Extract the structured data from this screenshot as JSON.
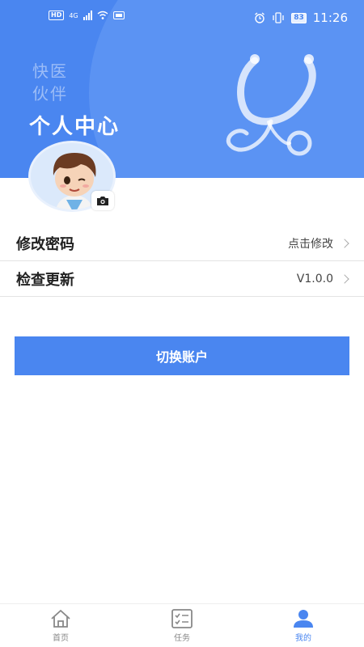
{
  "status_bar": {
    "left_icons": [
      "hd-icon",
      "signal-icon",
      "wifi-icon",
      "storage-icon"
    ],
    "hd_label": "HD",
    "network_label": "4G",
    "battery": "83",
    "time": "11:26"
  },
  "header": {
    "brand_line1": "快医",
    "brand_line2": "伙伴",
    "title": "个人中心"
  },
  "menu": [
    {
      "label": "修改密码",
      "value": "点击修改"
    },
    {
      "label": "检查更新",
      "value": "V1.0.0"
    }
  ],
  "switch_button_label": "切换账户",
  "tabs": [
    {
      "label": "首页",
      "icon": "home-icon",
      "active": false
    },
    {
      "label": "任务",
      "icon": "task-list-icon",
      "active": false
    },
    {
      "label": "我的",
      "icon": "user-icon",
      "active": true
    }
  ],
  "colors": {
    "primary": "#4a86f0",
    "header_circle": "#5b93f3",
    "inactive_tab": "#888888"
  }
}
